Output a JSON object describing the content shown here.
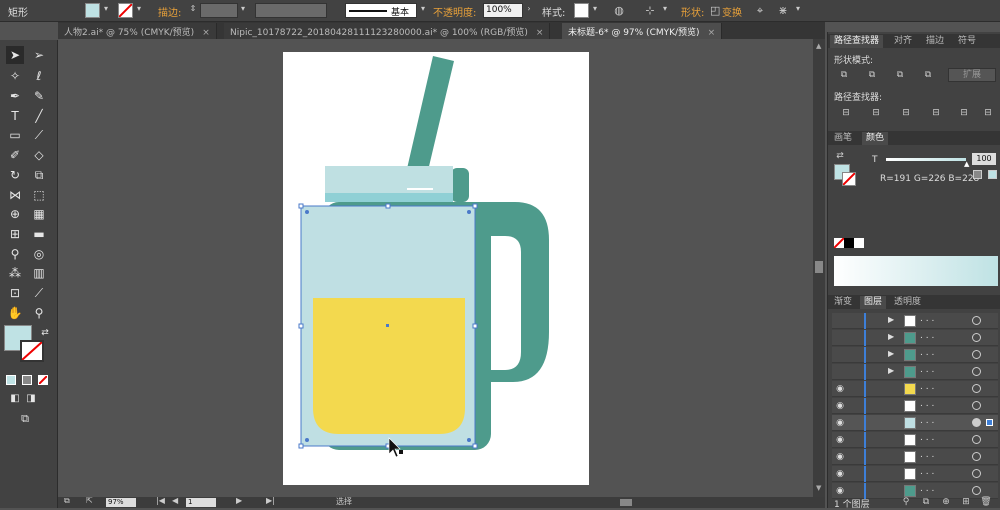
{
  "control_bar": {
    "object_type": "矩形",
    "stroke_label": "描边:",
    "stroke_profile": "基本",
    "opacity_label": "不透明度:",
    "opacity_value": "100%",
    "style_label": "样式:",
    "shape_label": "形状:",
    "transform_label": "变换",
    "fill_color": "#bfe2e4"
  },
  "tabs": [
    {
      "label": "人物2.ai* @ 75% (CMYK/预览)",
      "close": "×"
    },
    {
      "label": "Nipic_10178722_20180428111123280000.ai* @ 100% (RGB/预览)",
      "close": "×"
    },
    {
      "label": "未标题-6* @ 97% (CMYK/预览)",
      "close": "×"
    }
  ],
  "panels": {
    "pathfinder_tabs": [
      "路径查找器",
      "对齐",
      "描边",
      "符号"
    ],
    "shape_modes_label": "形状模式:",
    "expand_label": "扩展",
    "pathfinders_label": "路径查找器:",
    "color_tabs": [
      "画笔",
      "颜色"
    ],
    "t_label": "T",
    "t_value": "100",
    "rgb_readout": "R=191  G=226  B=228",
    "layer_tabs": [
      "渐变",
      "图层",
      "透明度"
    ],
    "layers_count": "1 个图层",
    "layer_dots": ". . ."
  },
  "status": {
    "zoom": "97%",
    "page": "1",
    "mode": "选择"
  },
  "artwork_colors": {
    "glass": "#bfdfe3",
    "lid": "#bfe0e2",
    "lid_stripe": "#8fd0d5",
    "juice": "#f3d94e",
    "teal": "#4e9b8c"
  }
}
